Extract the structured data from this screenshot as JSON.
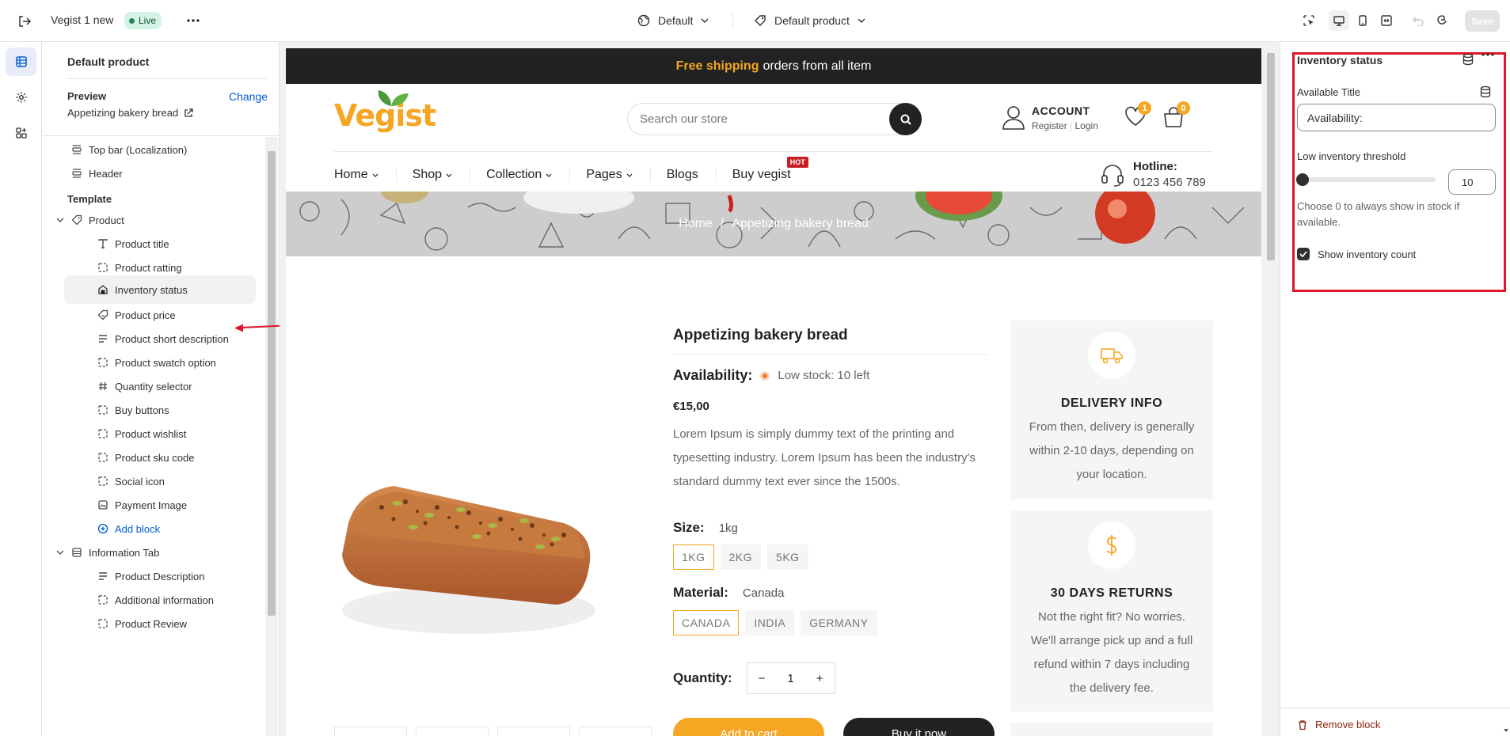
{
  "topbar": {
    "theme_name": "Vegist 1 new",
    "status_badge": "Live",
    "template_selector": "Default",
    "product_selector": "Default product",
    "save_label": "Save"
  },
  "left_panel": {
    "title": "Default product",
    "preview_label": "Preview",
    "change_label": "Change",
    "preview_value": "Appetizing bakery bread",
    "items": [
      {
        "label": "Top bar (Localization)",
        "icon": "section-icon"
      },
      {
        "label": "Header",
        "icon": "section-icon"
      }
    ],
    "template_heading": "Template",
    "product_section": "Product",
    "product_blocks": [
      {
        "label": "Product title",
        "icon": "text-icon"
      },
      {
        "label": "Product ratting",
        "icon": "block-icon"
      },
      {
        "label": "Inventory status",
        "icon": "inventory-icon"
      },
      {
        "label": "Product price",
        "icon": "price-tag-icon"
      },
      {
        "label": "Product short description",
        "icon": "lines-icon"
      },
      {
        "label": "Product swatch option",
        "icon": "block-icon"
      },
      {
        "label": "Quantity selector",
        "icon": "hash-icon"
      },
      {
        "label": "Buy buttons",
        "icon": "block-icon"
      },
      {
        "label": "Product wishlist",
        "icon": "block-icon"
      },
      {
        "label": "Product sku code",
        "icon": "block-icon"
      },
      {
        "label": "Social icon",
        "icon": "block-icon"
      },
      {
        "label": "Payment Image",
        "icon": "image-icon"
      }
    ],
    "add_block": "Add block",
    "info_section": "Information Tab",
    "info_blocks": [
      {
        "label": "Product Description",
        "icon": "lines-icon"
      },
      {
        "label": "Additional information",
        "icon": "block-icon"
      },
      {
        "label": "Product Review",
        "icon": "block-icon"
      }
    ]
  },
  "store": {
    "announcement_highlight": "Free shipping",
    "announcement_text": "orders from all item",
    "logo": "Vegist",
    "search_placeholder": "Search our store",
    "account_title": "ACCOUNT",
    "account_register": "Register",
    "account_login": "Login",
    "wishlist_count": "1",
    "cart_count": "0",
    "nav": [
      "Home",
      "Shop",
      "Collection",
      "Pages",
      "Blogs",
      "Buy vegist"
    ],
    "hot_badge": "HOT",
    "hotline_label": "Hotline:",
    "hotline_number": "0123 456 789",
    "crumb_home": "Home",
    "crumb_sep": "/",
    "crumb_current": "Appetizing bakery bread",
    "product_title": "Appetizing bakery bread",
    "availability_label": "Availability:",
    "availability_value": "Low stock: 10 left",
    "price": "€15,00",
    "description": "Lorem Ipsum is simply dummy text of the printing and typesetting industry. Lorem Ipsum has been the industry's standard dummy text ever since the 1500s.",
    "size_label": "Size:",
    "size_value": "1kg",
    "sizes": [
      "1KG",
      "2KG",
      "5KG"
    ],
    "material_label": "Material:",
    "material_value": "Canada",
    "materials": [
      "CANADA",
      "INDIA",
      "GERMANY"
    ],
    "quantity_label": "Quantity:",
    "quantity_minus": "−",
    "quantity_value": "1",
    "quantity_plus": "+",
    "add_to_cart": "Add to cart",
    "buy_now": "Buy it now",
    "cards": [
      {
        "title": "DELIVERY INFO",
        "text": "From then, delivery is generally within 2-10 days, depending on your location."
      },
      {
        "title": "30 DAYS RETURNS",
        "text": "Not the right fit? No worries. We'll arrange pick up and a full refund within 7 days including the delivery fee."
      }
    ],
    "accent_color": "#f5a623"
  },
  "right_panel": {
    "title": "Inventory status",
    "available_title_label": "Available Title",
    "available_title_value": "Availability:",
    "threshold_label": "Low inventory threshold",
    "threshold_value": "10",
    "threshold_fraction": 0.0,
    "help_text": "Choose 0 to always show in stock if available.",
    "show_count_label": "Show inventory count",
    "show_count_checked": true,
    "remove_block": "Remove block"
  }
}
